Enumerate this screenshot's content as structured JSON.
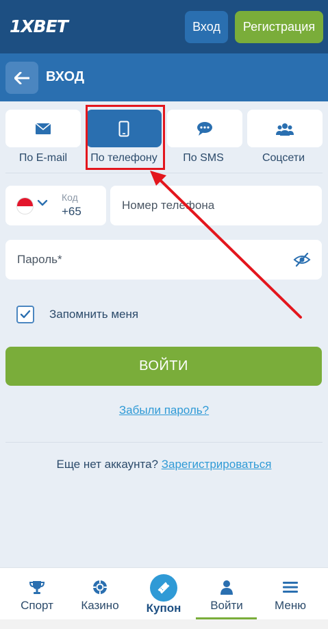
{
  "header": {
    "logo": "1XBET",
    "login_label": "Вход",
    "register_label": "Регистрация"
  },
  "subheader": {
    "title": "ВХОД"
  },
  "tabs": [
    {
      "label": "По E-mail",
      "icon": "envelope-icon"
    },
    {
      "label": "По телефону",
      "icon": "smartphone-icon",
      "active": true
    },
    {
      "label": "По SMS",
      "icon": "chat-bubble-icon"
    },
    {
      "label": "Соцсети",
      "icon": "people-icon"
    }
  ],
  "form": {
    "code_label": "Код",
    "code_value": "+65",
    "phone_placeholder": "Номер телефона",
    "password_placeholder": "Пароль*",
    "remember_label": "Запомнить меня",
    "submit_label": "ВОЙТИ",
    "forgot_label": "Забыли пароль?",
    "no_account_text": "Еще нет аккаунта?",
    "register_link": "Зарегистрироваться"
  },
  "bottom_nav": {
    "items": [
      {
        "label": "Спорт",
        "icon": "trophy-icon"
      },
      {
        "label": "Казино",
        "icon": "casino-chip-icon"
      },
      {
        "label": "Купон",
        "icon": "ticket-icon"
      },
      {
        "label": "Войти",
        "icon": "user-icon",
        "active": true
      },
      {
        "label": "Меню",
        "icon": "hamburger-menu-icon"
      }
    ]
  },
  "colors": {
    "header_bg": "#1d4f82",
    "subheader_bg": "#2a6fb0",
    "accent_green": "#7aad3a",
    "link_blue": "#2f9ad6",
    "highlight_red": "#e3161d"
  }
}
